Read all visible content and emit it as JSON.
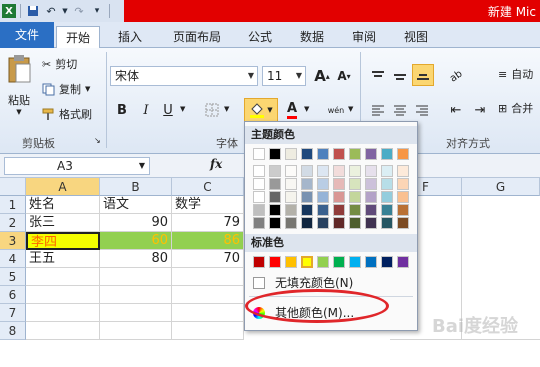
{
  "window": {
    "title": "新建 Mic"
  },
  "tabs": {
    "file": "文件",
    "home": "开始",
    "insert": "插入",
    "layout": "页面布局",
    "formula": "公式",
    "data": "数据",
    "review": "审阅",
    "view": "视图"
  },
  "clipboard": {
    "paste": "粘贴",
    "cut": "剪切",
    "copy": "复制",
    "format_painter": "格式刷",
    "group": "剪贴板"
  },
  "font": {
    "name": "宋体",
    "size": "11",
    "grow": "A",
    "shrink": "A",
    "bold": "B",
    "italic": "I",
    "underline": "U",
    "group": "字体",
    "phonetic": "wén"
  },
  "alignment": {
    "group": "对齐方式",
    "wrap": "自动",
    "merge": "合并"
  },
  "formula_bar": {
    "name_box": "A3",
    "fx": "fx"
  },
  "columns": [
    "A",
    "B",
    "C",
    "F",
    "G"
  ],
  "rows": [
    "1",
    "2",
    "3",
    "4",
    "5",
    "6",
    "7",
    "8"
  ],
  "cells": {
    "a1": "姓名",
    "b1": "语文",
    "c1": "数学",
    "a2": "张三",
    "b2": "90",
    "c2": "79",
    "a3": "李四",
    "b3": "60",
    "c3": "86",
    "a4": "王五",
    "b4": "80",
    "c4": "70"
  },
  "color_menu": {
    "theme_header": "主题颜色",
    "standard_header": "标准色",
    "no_fill": "无填充颜色(N)",
    "more_colors": "其他颜色(M)..."
  },
  "colors": {
    "theme_top": [
      "#ffffff",
      "#000000",
      "#eeece1",
      "#1f497d",
      "#4f81bd",
      "#c0504d",
      "#9bbb59",
      "#8064a2",
      "#4bacc6",
      "#f79646"
    ],
    "standard": [
      "#c00000",
      "#ff0000",
      "#ffc000",
      "#ffff00",
      "#92d050",
      "#00b050",
      "#00b0f0",
      "#0070c0",
      "#002060",
      "#7030a0"
    ],
    "highlight_row": "#f5ff00",
    "green_fill": "#92d050",
    "red_text": "#ff0000",
    "yellow_text": "#ffc000"
  },
  "watermark": "Bai度经验"
}
